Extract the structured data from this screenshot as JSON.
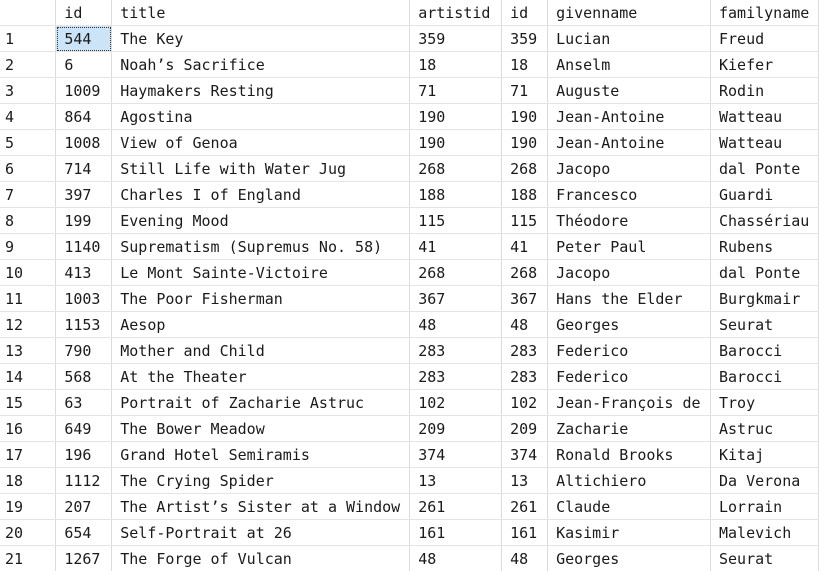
{
  "results": {
    "columns": [
      "id",
      "title",
      "artistid",
      "id",
      "givenname",
      "familyname"
    ],
    "rows": [
      [
        "1",
        "544",
        "The Key",
        "359",
        "359",
        "Lucian",
        "Freud"
      ],
      [
        "2",
        "6",
        "Noah’s Sacrifice",
        "18",
        "18",
        "Anselm",
        "Kiefer"
      ],
      [
        "3",
        "1009",
        "Haymakers Resting",
        "71",
        "71",
        "Auguste",
        "Rodin"
      ],
      [
        "4",
        "864",
        "Agostina",
        "190",
        "190",
        "Jean-Antoine",
        "Watteau"
      ],
      [
        "5",
        "1008",
        "View of Genoa",
        "190",
        "190",
        "Jean-Antoine",
        "Watteau"
      ],
      [
        "6",
        "714",
        "Still Life with Water Jug",
        "268",
        "268",
        "Jacopo",
        "dal Ponte"
      ],
      [
        "7",
        "397",
        "Charles I of England",
        "188",
        "188",
        "Francesco",
        "Guardi"
      ],
      [
        "8",
        "199",
        "Evening Mood",
        "115",
        "115",
        "Théodore",
        "Chassériau"
      ],
      [
        "9",
        "1140",
        "Suprematism (Supremus No. 58)",
        "41",
        "41",
        "Peter Paul",
        "Rubens"
      ],
      [
        "10",
        "413",
        "Le Mont Sainte-Victoire",
        "268",
        "268",
        "Jacopo",
        "dal Ponte"
      ],
      [
        "11",
        "1003",
        "The Poor Fisherman",
        "367",
        "367",
        "Hans the Elder",
        "Burgkmair"
      ],
      [
        "12",
        "1153",
        "Aesop",
        "48",
        "48",
        "Georges",
        "Seurat"
      ],
      [
        "13",
        "790",
        "Mother and Child",
        "283",
        "283",
        "Federico",
        "Barocci"
      ],
      [
        "14",
        "568",
        "At the Theater",
        "283",
        "283",
        "Federico",
        "Barocci"
      ],
      [
        "15",
        "63",
        "Portrait of Zacharie Astruc",
        "102",
        "102",
        "Jean-François de",
        "Troy"
      ],
      [
        "16",
        "649",
        "The Bower Meadow",
        "209",
        "209",
        "Zacharie",
        "Astruc"
      ],
      [
        "17",
        "196",
        "Grand Hotel Semiramis",
        "374",
        "374",
        "Ronald Brooks",
        "Kitaj"
      ],
      [
        "18",
        "1112",
        "The Crying Spider",
        "13",
        "13",
        "Altichiero",
        "Da Verona"
      ],
      [
        "19",
        "207",
        "The Artist’s Sister at a Window",
        "261",
        "261",
        "Claude",
        "Lorrain"
      ],
      [
        "20",
        "654",
        "Self-Portrait at 26",
        "161",
        "161",
        "Kasimir",
        "Malevich"
      ],
      [
        "21",
        "1267",
        "The Forge of Vulcan",
        "48",
        "48",
        "Georges",
        "Seurat"
      ]
    ],
    "selected_cell": {
      "row": 0,
      "col": 1
    }
  }
}
